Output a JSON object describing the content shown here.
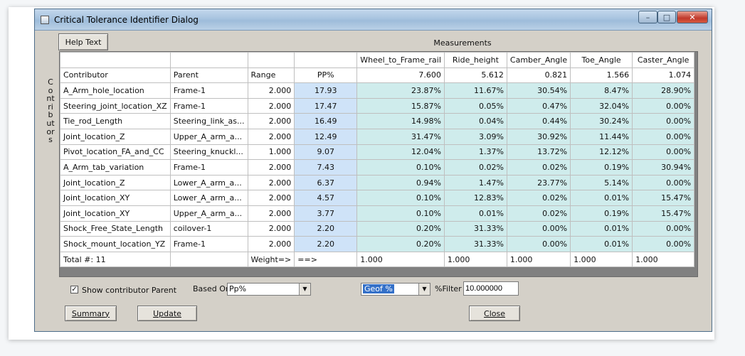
{
  "window": {
    "title": "Critical Tolerance Identifier Dialog",
    "min_glyph": "–",
    "max_glyph": "□",
    "close_glyph": "✕"
  },
  "toolbar": {
    "help_label": "Help Text"
  },
  "header": {
    "measurements_label": "Measurements"
  },
  "side_label": "Contributors",
  "grid": {
    "measures": [
      {
        "name": "Wheel_to_Frame_rail",
        "nominal": "7.600"
      },
      {
        "name": "Ride_height",
        "nominal": "5.612"
      },
      {
        "name": "Camber_Angle",
        "nominal": "0.821"
      },
      {
        "name": "Toe_Angle",
        "nominal": "1.566"
      },
      {
        "name": "Caster_Angle",
        "nominal": "1.074"
      }
    ],
    "columns": {
      "contributor": "Contributor",
      "parent": "Parent",
      "range": "Range",
      "pp": "PP%"
    },
    "rows": [
      {
        "contributor": "A_Arm_hole_location",
        "parent": "Frame-1",
        "range": "2.000",
        "pp": "17.93",
        "m": [
          "23.87%",
          "11.67%",
          "30.54%",
          "8.47%",
          "28.90%"
        ]
      },
      {
        "contributor": "Steering_joint_location_XZ",
        "parent": "Frame-1",
        "range": "2.000",
        "pp": "17.47",
        "m": [
          "15.87%",
          "0.05%",
          "0.47%",
          "32.04%",
          "0.00%"
        ]
      },
      {
        "contributor": "Tie_rod_Length",
        "parent": "Steering_link_as...",
        "range": "2.000",
        "pp": "16.49",
        "m": [
          "14.98%",
          "0.04%",
          "0.44%",
          "30.24%",
          "0.00%"
        ]
      },
      {
        "contributor": "Joint_location_Z",
        "parent": "Upper_A_arm_a...",
        "range": "2.000",
        "pp": "12.49",
        "m": [
          "31.47%",
          "3.09%",
          "30.92%",
          "11.44%",
          "0.00%"
        ]
      },
      {
        "contributor": "Pivot_location_FA_and_CC",
        "parent": "Steering_knuckl...",
        "range": "1.000",
        "pp": "9.07",
        "m": [
          "12.04%",
          "1.37%",
          "13.72%",
          "12.12%",
          "0.00%"
        ]
      },
      {
        "contributor": "A_Arm_tab_variation",
        "parent": "Frame-1",
        "range": "2.000",
        "pp": "7.43",
        "m": [
          "0.10%",
          "0.02%",
          "0.02%",
          "0.19%",
          "30.94%"
        ]
      },
      {
        "contributor": "Joint_location_Z",
        "parent": "Lower_A_arm_a...",
        "range": "2.000",
        "pp": "6.37",
        "m": [
          "0.94%",
          "1.47%",
          "23.77%",
          "5.14%",
          "0.00%"
        ]
      },
      {
        "contributor": "Joint_location_XY",
        "parent": "Lower_A_arm_a...",
        "range": "2.000",
        "pp": "4.57",
        "m": [
          "0.10%",
          "12.83%",
          "0.02%",
          "0.01%",
          "15.47%"
        ]
      },
      {
        "contributor": "Joint_location_XY",
        "parent": "Upper_A_arm_a...",
        "range": "2.000",
        "pp": "3.77",
        "m": [
          "0.10%",
          "0.01%",
          "0.02%",
          "0.19%",
          "15.47%"
        ]
      },
      {
        "contributor": "Shock_Free_State_Length",
        "parent": "coilover-1",
        "range": "2.000",
        "pp": "2.20",
        "m": [
          "0.20%",
          "31.33%",
          "0.00%",
          "0.01%",
          "0.00%"
        ]
      },
      {
        "contributor": "Shock_mount_location_YZ",
        "parent": "Frame-1",
        "range": "2.000",
        "pp": "2.20",
        "m": [
          "0.20%",
          "31.33%",
          "0.00%",
          "0.01%",
          "0.00%"
        ]
      }
    ],
    "total": {
      "label": "Total #: 11",
      "weight_label": "Weight=>",
      "arrow": "==>",
      "weights": [
        "1.000",
        "1.000",
        "1.000",
        "1.000",
        "1.000"
      ]
    }
  },
  "options": {
    "show_parent_label": "Show contributor Parent",
    "show_parent_checked": true,
    "based_on_label": "Based On",
    "based_on_value": "Pp%",
    "geof_value": "Geof %",
    "filter_label": "%Filter",
    "filter_value": "10.000000"
  },
  "buttons": {
    "summary": "Summary",
    "update": "Update",
    "close": "Close"
  }
}
